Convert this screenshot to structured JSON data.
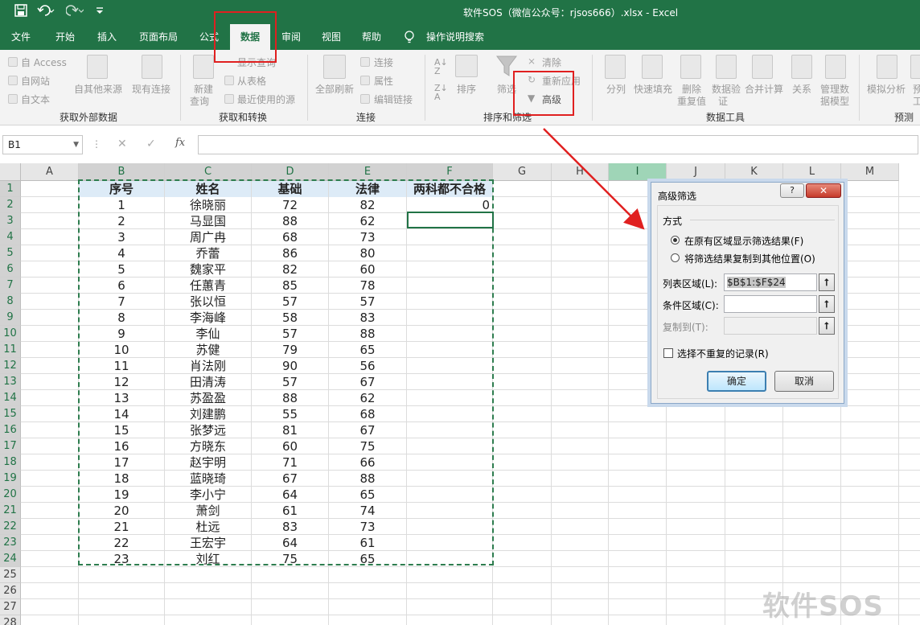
{
  "window": {
    "title": "软件SOS（微信公众号：rjsos666）.xlsx  -  Excel"
  },
  "quick_access": [
    "save-icon",
    "undo-icon",
    "redo-icon",
    "customize-icon"
  ],
  "tabs": [
    "文件",
    "开始",
    "插入",
    "页面布局",
    "公式",
    "数据",
    "审阅",
    "视图",
    "帮助",
    "操作说明搜索"
  ],
  "active_tab": "数据",
  "ribbon": {
    "get_external": {
      "access": "自 Access",
      "web": "自网站",
      "text": "自文本",
      "other": "自其他来源",
      "existing": "现有连接",
      "label": "获取外部数据"
    },
    "transform": {
      "new_query": "新建",
      "new_query2": "查询",
      "show_query": "显示查询",
      "from_table": "从表格",
      "recent": "最近使用的源",
      "label": "获取和转换"
    },
    "connections": {
      "refresh_all": "全部刷新",
      "connections": "连接",
      "properties": "属性",
      "edit_links": "编辑链接",
      "label": "连接"
    },
    "sort_filter": {
      "sort": "排序",
      "filter": "筛选",
      "clear": "清除",
      "reapply": "重新应用",
      "advanced": "高级",
      "label": "排序和筛选"
    },
    "data_tools": {
      "split": "分列",
      "flash_fill": "快速填充",
      "remove_dup": "删除",
      "remove_dup2": "重复值",
      "validation": "数据验",
      "validation2": "证",
      "consolidate": "合并计算",
      "relationships": "关系",
      "data_model": "管理数",
      "data_model2": "据模型",
      "label": "数据工具"
    },
    "forecast": {
      "what_if": "模拟分析",
      "forecast_sheet": "预",
      "forecast_sheet2": "工",
      "label": "预测"
    }
  },
  "formula_bar": {
    "name_box": "B1",
    "cancel": "✕",
    "enter": "✓",
    "fx": "fx",
    "value": ""
  },
  "columns": [
    "A",
    "B",
    "C",
    "D",
    "E",
    "F",
    "G",
    "H",
    "I",
    "J",
    "K",
    "L",
    "M"
  ],
  "rows": [
    "1",
    "2",
    "3",
    "4",
    "5",
    "6",
    "7",
    "8",
    "9",
    "10",
    "11",
    "12",
    "13",
    "14",
    "15",
    "16",
    "17",
    "18",
    "19",
    "20",
    "21",
    "22",
    "23",
    "24",
    "25",
    "26",
    "27",
    "28"
  ],
  "headers": [
    "序号",
    "姓名",
    "基础",
    "法律",
    "两科都不合格"
  ],
  "data_rows": [
    [
      "1",
      "徐晓丽",
      "72",
      "82"
    ],
    [
      "2",
      "马显国",
      "88",
      "62"
    ],
    [
      "3",
      "周广冉",
      "68",
      "73"
    ],
    [
      "4",
      "乔蕾",
      "86",
      "80"
    ],
    [
      "5",
      "魏家平",
      "82",
      "60"
    ],
    [
      "6",
      "任蕙青",
      "85",
      "78"
    ],
    [
      "7",
      "张以恒",
      "57",
      "57"
    ],
    [
      "8",
      "李海峰",
      "58",
      "83"
    ],
    [
      "9",
      "李仙",
      "57",
      "88"
    ],
    [
      "10",
      "苏健",
      "79",
      "65"
    ],
    [
      "11",
      "肖法刚",
      "90",
      "56"
    ],
    [
      "12",
      "田清涛",
      "57",
      "67"
    ],
    [
      "13",
      "苏盈盈",
      "88",
      "62"
    ],
    [
      "14",
      "刘建鹏",
      "55",
      "68"
    ],
    [
      "15",
      "张梦远",
      "81",
      "67"
    ],
    [
      "16",
      "方晓东",
      "60",
      "75"
    ],
    [
      "17",
      "赵宇明",
      "71",
      "66"
    ],
    [
      "18",
      "蓝晓琦",
      "67",
      "88"
    ],
    [
      "19",
      "李小宁",
      "64",
      "65"
    ],
    [
      "20",
      "萧剑",
      "61",
      "74"
    ],
    [
      "21",
      "杜远",
      "83",
      "73"
    ],
    [
      "22",
      "王宏宇",
      "64",
      "61"
    ],
    [
      "23",
      "刘红",
      "75",
      "65"
    ]
  ],
  "f2_value": "0",
  "dialog": {
    "title": "高级筛选",
    "help": "?",
    "close": "✕",
    "section": "方式",
    "radio_in_place": "在原有区域显示筛选结果(F)",
    "radio_copy": "将筛选结果复制到其他位置(O)",
    "list_range_label": "列表区域(L):",
    "list_range_value": "$B$1:$F$24",
    "criteria_label": "条件区域(C):",
    "criteria_value": "",
    "copy_to_label": "复制到(T):",
    "copy_to_value": "",
    "unique_label": "选择不重复的记录(R)",
    "ok": "确定",
    "cancel": "取消"
  },
  "watermark": "软件SOS",
  "colors": {
    "excel_green": "#217346",
    "highlight_red": "#e02020",
    "header_fill": "#ddebf7"
  }
}
